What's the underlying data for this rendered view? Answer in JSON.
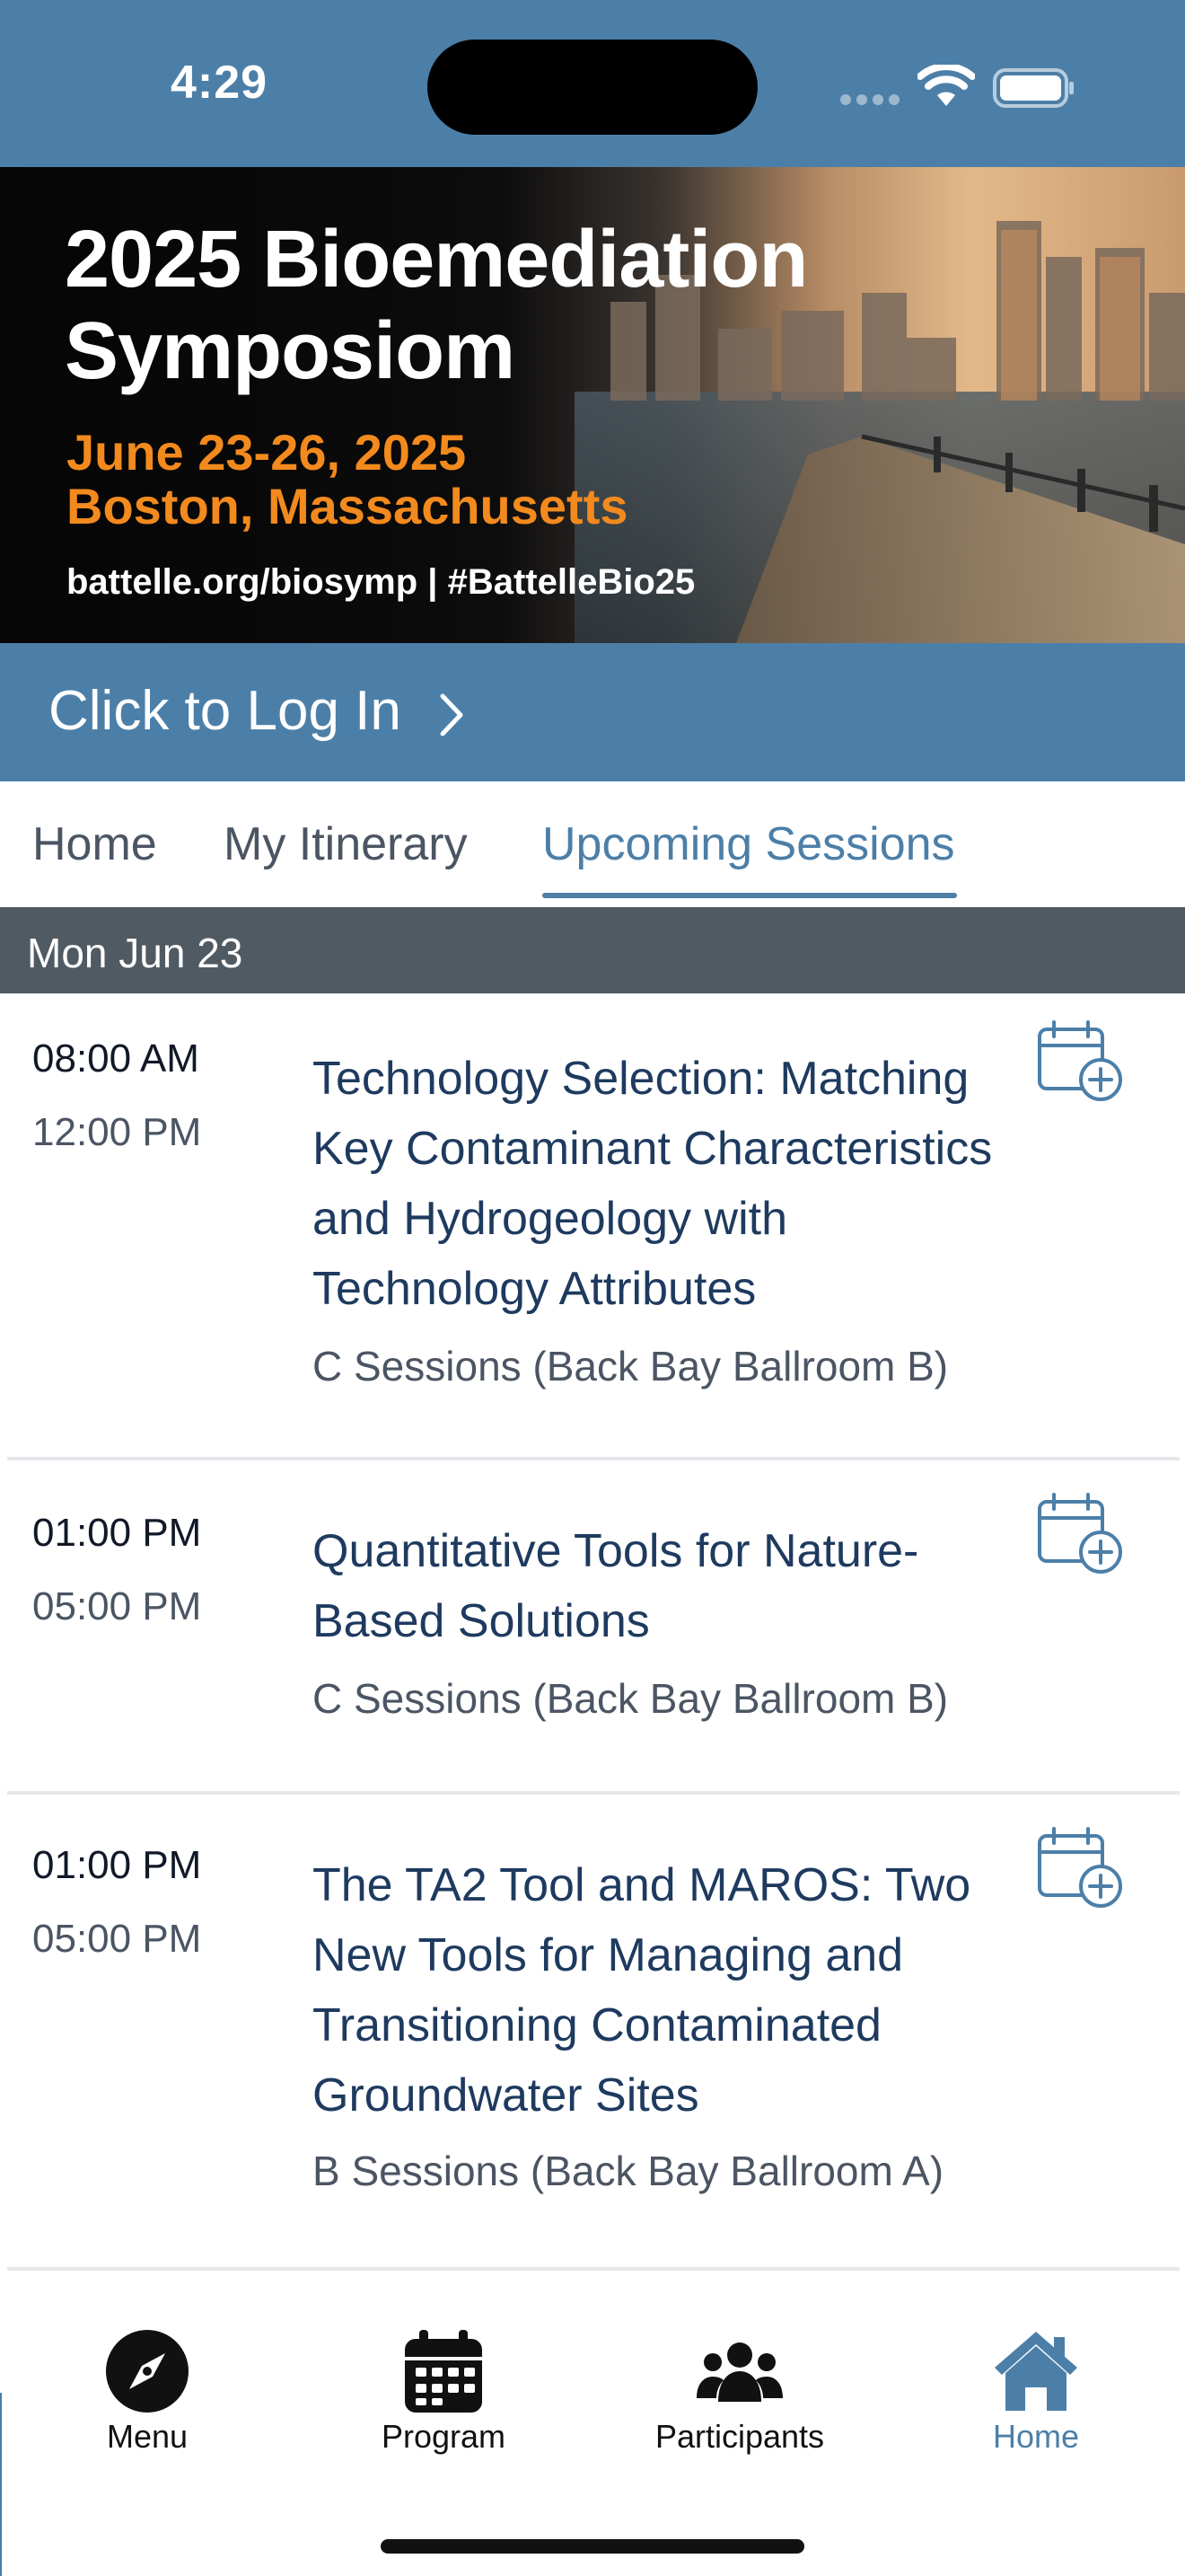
{
  "status_bar": {
    "time": "4:29"
  },
  "banner": {
    "title_line1": "2025 Bioemediation",
    "title_line2": "Symposiom",
    "dates_line1": "June 23-26, 2025",
    "dates_line2": "Boston, Massachusetts",
    "url": "battelle.org/biosymp | #BattelleBio25"
  },
  "login": {
    "label": "Click to Log In"
  },
  "tabs": [
    {
      "label": "Home",
      "active": false
    },
    {
      "label": "My Itinerary",
      "active": false
    },
    {
      "label": "Upcoming Sessions",
      "active": true
    }
  ],
  "day_header": "Mon Jun 23",
  "sessions": [
    {
      "start": "08:00 AM",
      "end": "12:00 PM",
      "title": "Technology Selection: Matching Key Contaminant Characteristics and Hydrogeology with Technology Attributes",
      "room": "C Sessions (Back Bay Ballroom B)"
    },
    {
      "start": "01:00 PM",
      "end": "05:00 PM",
      "title": "Quantitative Tools for Nature-Based Solutions",
      "room": "C Sessions (Back Bay Ballroom B)"
    },
    {
      "start": "01:00 PM",
      "end": "05:00 PM",
      "title": "The TA2 Tool and MAROS: Two New Tools for Managing and Transitioning Contaminated Groundwater Sites",
      "room": "B Sessions (Back Bay Ballroom A)"
    }
  ],
  "tabbar": [
    {
      "label": "Menu",
      "icon": "compass-icon",
      "active": false
    },
    {
      "label": "Program",
      "icon": "calendar-icon",
      "active": false
    },
    {
      "label": "Participants",
      "icon": "users-icon",
      "active": false
    },
    {
      "label": "Home",
      "icon": "home-icon",
      "active": true
    }
  ],
  "colors": {
    "brand_blue": "#4c7fa8",
    "day_header": "#505a63",
    "session_title": "#1e3a5f",
    "banner_orange": "#f28a1e"
  }
}
